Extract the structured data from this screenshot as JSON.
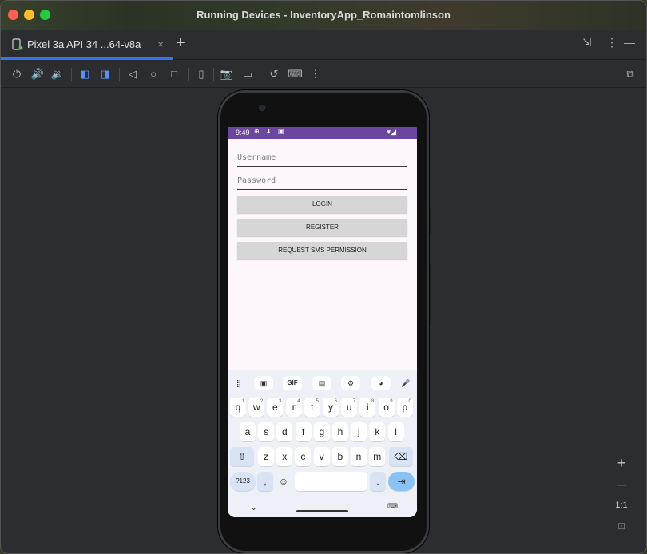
{
  "window": {
    "title": "Running Devices - InventoryApp_Romaintomlinson"
  },
  "tabs": [
    {
      "label": "Pixel 3a API 34 ...64-v8a",
      "close": "×"
    }
  ],
  "tab_add": "+",
  "tabbar_right": {
    "minimize_icon": "⇲",
    "more": "⋮",
    "hide": "—"
  },
  "toolbar": {
    "icons": [
      "power-icon",
      "volume-up-icon",
      "volume-down-icon",
      "rotate-left-icon",
      "rotate-right-icon",
      "back-icon",
      "home-icon",
      "overview-icon",
      "device-frame-icon",
      "screenshot-icon",
      "screen-record-icon",
      "reset-icon",
      "keyboard-icon",
      "more-icon",
      "device-explorer-icon"
    ]
  },
  "device": {
    "status_bar": {
      "time": "9:49",
      "icons": "⊕ ⬇ ▣",
      "right_icons": "▾◢"
    },
    "app": {
      "username_placeholder": "Username",
      "password_placeholder": "Password",
      "login_label": "LOGIN",
      "register_label": "REGISTER",
      "sms_permission_label": "REQUEST SMS PERMISSION"
    },
    "keyboard": {
      "toolbar": [
        "⣿",
        "▣",
        "GIF",
        "▤",
        "⚙",
        "◕",
        "🎤"
      ],
      "row1": [
        {
          "k": "q",
          "s": "1"
        },
        {
          "k": "w",
          "s": "2"
        },
        {
          "k": "e",
          "s": "3"
        },
        {
          "k": "r",
          "s": "4"
        },
        {
          "k": "t",
          "s": "5"
        },
        {
          "k": "y",
          "s": "6"
        },
        {
          "k": "u",
          "s": "7"
        },
        {
          "k": "i",
          "s": "8"
        },
        {
          "k": "o",
          "s": "9"
        },
        {
          "k": "p",
          "s": "0"
        }
      ],
      "row2": [
        "a",
        "s",
        "d",
        "f",
        "g",
        "h",
        "j",
        "k",
        "l"
      ],
      "row3": [
        "z",
        "x",
        "c",
        "v",
        "b",
        "n",
        "m"
      ],
      "shift": "⇧",
      "backspace": "⌫",
      "symbols": "?123",
      "comma": ",",
      "emoji": "☺",
      "period": ".",
      "action": "⇥",
      "hide_keyboard": "⌄",
      "switch_keyboard": "⌨"
    }
  },
  "zoom_controls": {
    "zoom_in": "+",
    "zoom_out": "—",
    "actual_size": "1:1",
    "fit": "⊡"
  },
  "colors": {
    "status_bar": "#6a46a0",
    "tab_underline": "#3574f0",
    "app_background": "#fdf7fc",
    "button": "#d6d6d6",
    "keyboard_action": "#8ac2f4"
  }
}
